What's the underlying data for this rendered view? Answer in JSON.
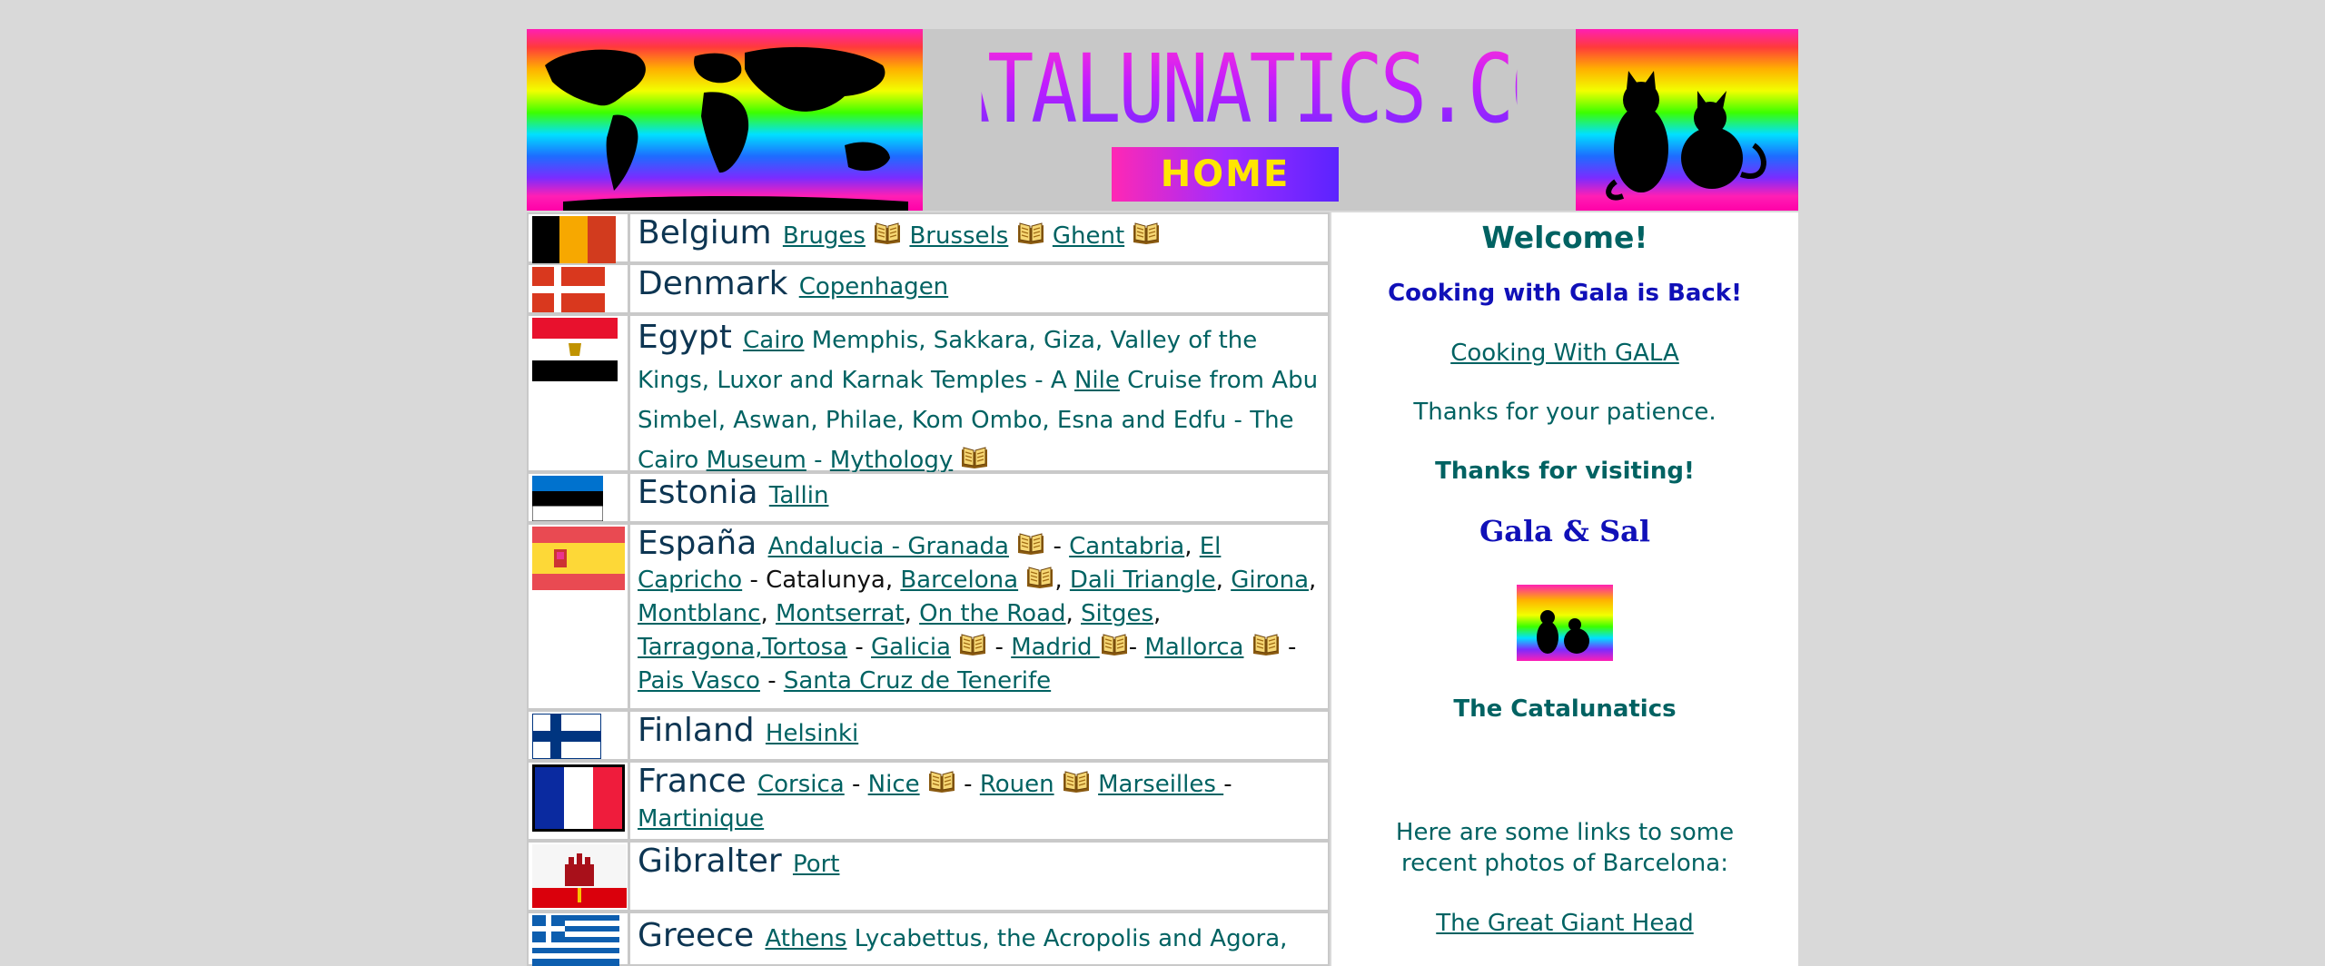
{
  "header": {
    "site_name": "CATALUNATICS.COM",
    "home_label": "HOME"
  },
  "countries": [
    {
      "name": "Belgium",
      "flag": "flag-belgium"
    },
    {
      "name": "Denmark",
      "flag": "flag-denmark"
    },
    {
      "name": "Egypt",
      "flag": "flag-egypt"
    },
    {
      "name": "Estonia",
      "flag": "flag-estonia"
    },
    {
      "name": "España",
      "flag": "flag-spain"
    },
    {
      "name": "Finland",
      "flag": "flag-finland"
    },
    {
      "name": "France",
      "flag": "flag-france"
    },
    {
      "name": "Gibralter",
      "flag": "flag-gibraltar"
    },
    {
      "name": "Greece",
      "flag": "flag-greece"
    }
  ],
  "links": {
    "bruges": "Bruges",
    "brussels": "Brussels",
    "ghent": "Ghent",
    "copenhagen": "Copenhagen",
    "cairo": "Cairo",
    "nile": "Nile",
    "museum": "Museum",
    "mythology": "Mythology",
    "tallin": "Tallin",
    "andalucia": "Andalucia - Granada",
    "cantabria": "Cantabria",
    "el": "El",
    "capricho": "Capricho",
    "barcelona": "Barcelona",
    "dali": "Dali Triangle",
    "girona": "Girona",
    "montblanc": "Montblanc",
    "montserrat": "Montserrat",
    "road": "On the Road",
    "sitges": "Sitges",
    "tarragona": "Tarragona,",
    "tortosa": "Tortosa",
    "galicia": "Galicia",
    "madrid": "Madrid ",
    "mallorca": "Mallorca",
    "pais": "Pais Vasco",
    "tenerife": "Santa Cruz de Tenerife",
    "helsinki": "Helsinki",
    "corsica": "Corsica",
    "nice": "Nice",
    "rouen": "Rouen",
    "marseilles": "Marseilles ",
    "martinique": "Martinique",
    "port": "Port",
    "athens": "Athens"
  },
  "text": {
    "egypt_1": " Memphis, Sakkara, Giza, Valley of the Kings, Luxor and Karnak Temples -  A ",
    "egypt_2": " Cruise from Abu Simbel, Aswan, Philae, Kom Ombo, Esna and Edfu - The Cairo ",
    "dash": " - ",
    "comma": ", ",
    "catalunya": " - Catalunya, ",
    "greece_1": " Lycabettus, the Acropolis and Agora,"
  },
  "sidebar": {
    "welcome": "Welcome!",
    "cooking_back": "Cooking with Gala is Back!",
    "cooking_link": "Cooking With GALA",
    "patience": "Thanks for your patience.",
    "visiting": "Thanks for visiting!",
    "signature": "Gala & Sal",
    "catalunatics": "The Catalunatics",
    "recent": "Here are some links to some recent photos of Barcelona:",
    "giant_head": "The Great Giant Head"
  },
  "colors": {
    "page_bg": "#d9d9d9",
    "link": "#006262",
    "country": "#0d3552",
    "accent_blue": "#1010b8",
    "home_text": "#ffe600"
  }
}
